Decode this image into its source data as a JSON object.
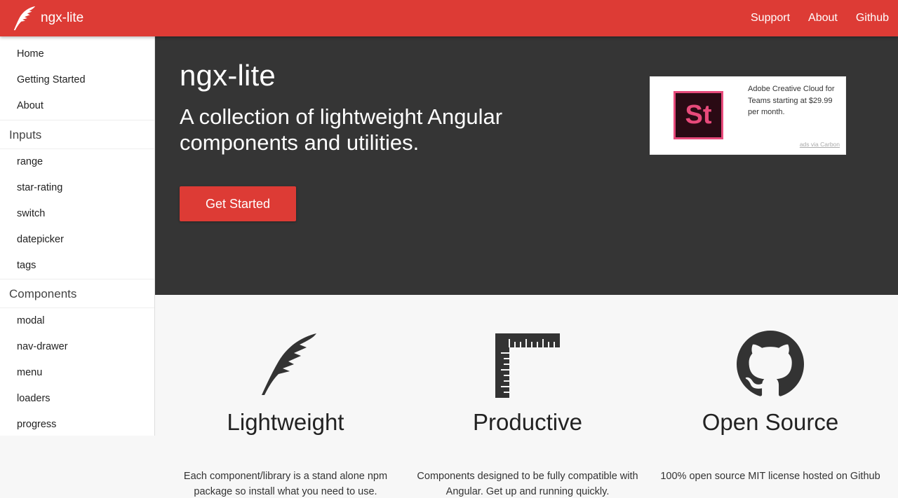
{
  "header": {
    "brand": "ngx-lite",
    "nav": [
      "Support",
      "About",
      "Github"
    ]
  },
  "sidebar": {
    "top": [
      "Home",
      "Getting Started",
      "About"
    ],
    "sections": [
      {
        "title": "Inputs",
        "items": [
          "range",
          "star-rating",
          "switch",
          "datepicker",
          "tags"
        ]
      },
      {
        "title": "Components",
        "items": [
          "modal",
          "nav-drawer",
          "menu",
          "loaders",
          "progress"
        ]
      }
    ]
  },
  "hero": {
    "title": "ngx-lite",
    "subtitle": "A collection of lightweight Angular components and utilities.",
    "cta": "Get Started"
  },
  "ad": {
    "logo_text": "St",
    "text": "Adobe Creative Cloud for Teams starting at $29.99 per month.",
    "via": "ads via Carbon"
  },
  "features": [
    {
      "icon": "feather-icon",
      "title": "Lightweight",
      "desc": "Each component/library is a stand alone npm package so install what you need to use."
    },
    {
      "icon": "ruler-icon",
      "title": "Productive",
      "desc": "Components designed to be fully compatible with Angular. Get up and running quickly."
    },
    {
      "icon": "github-icon",
      "title": "Open Source",
      "desc": "100% open source MIT license hosted on Github"
    }
  ],
  "colors": {
    "primary": "#dd3b35",
    "hero_bg": "#353535",
    "body_bg": "#f7f7f7"
  }
}
